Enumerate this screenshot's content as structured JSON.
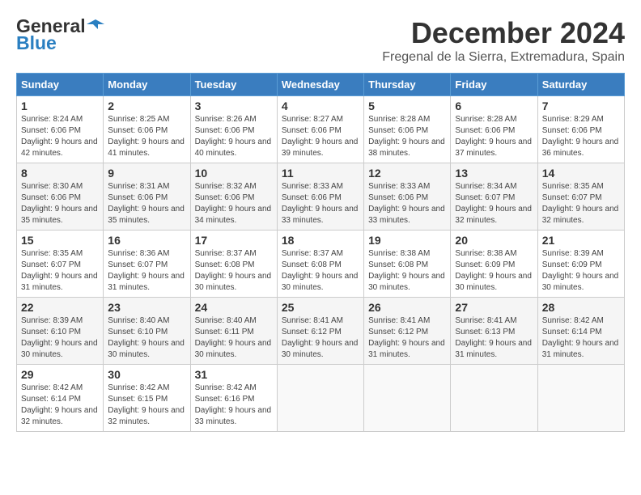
{
  "header": {
    "logo_general": "General",
    "logo_blue": "Blue",
    "month": "December 2024",
    "location": "Fregenal de la Sierra, Extremadura, Spain"
  },
  "days_of_week": [
    "Sunday",
    "Monday",
    "Tuesday",
    "Wednesday",
    "Thursday",
    "Friday",
    "Saturday"
  ],
  "weeks": [
    [
      {
        "day": 1,
        "sunrise": "8:24 AM",
        "sunset": "6:06 PM",
        "daylight": "9 hours and 42 minutes."
      },
      {
        "day": 2,
        "sunrise": "8:25 AM",
        "sunset": "6:06 PM",
        "daylight": "9 hours and 41 minutes."
      },
      {
        "day": 3,
        "sunrise": "8:26 AM",
        "sunset": "6:06 PM",
        "daylight": "9 hours and 40 minutes."
      },
      {
        "day": 4,
        "sunrise": "8:27 AM",
        "sunset": "6:06 PM",
        "daylight": "9 hours and 39 minutes."
      },
      {
        "day": 5,
        "sunrise": "8:28 AM",
        "sunset": "6:06 PM",
        "daylight": "9 hours and 38 minutes."
      },
      {
        "day": 6,
        "sunrise": "8:28 AM",
        "sunset": "6:06 PM",
        "daylight": "9 hours and 37 minutes."
      },
      {
        "day": 7,
        "sunrise": "8:29 AM",
        "sunset": "6:06 PM",
        "daylight": "9 hours and 36 minutes."
      }
    ],
    [
      {
        "day": 8,
        "sunrise": "8:30 AM",
        "sunset": "6:06 PM",
        "daylight": "9 hours and 35 minutes."
      },
      {
        "day": 9,
        "sunrise": "8:31 AM",
        "sunset": "6:06 PM",
        "daylight": "9 hours and 35 minutes."
      },
      {
        "day": 10,
        "sunrise": "8:32 AM",
        "sunset": "6:06 PM",
        "daylight": "9 hours and 34 minutes."
      },
      {
        "day": 11,
        "sunrise": "8:33 AM",
        "sunset": "6:06 PM",
        "daylight": "9 hours and 33 minutes."
      },
      {
        "day": 12,
        "sunrise": "8:33 AM",
        "sunset": "6:06 PM",
        "daylight": "9 hours and 33 minutes."
      },
      {
        "day": 13,
        "sunrise": "8:34 AM",
        "sunset": "6:07 PM",
        "daylight": "9 hours and 32 minutes."
      },
      {
        "day": 14,
        "sunrise": "8:35 AM",
        "sunset": "6:07 PM",
        "daylight": "9 hours and 32 minutes."
      }
    ],
    [
      {
        "day": 15,
        "sunrise": "8:35 AM",
        "sunset": "6:07 PM",
        "daylight": "9 hours and 31 minutes."
      },
      {
        "day": 16,
        "sunrise": "8:36 AM",
        "sunset": "6:07 PM",
        "daylight": "9 hours and 31 minutes."
      },
      {
        "day": 17,
        "sunrise": "8:37 AM",
        "sunset": "6:08 PM",
        "daylight": "9 hours and 30 minutes."
      },
      {
        "day": 18,
        "sunrise": "8:37 AM",
        "sunset": "6:08 PM",
        "daylight": "9 hours and 30 minutes."
      },
      {
        "day": 19,
        "sunrise": "8:38 AM",
        "sunset": "6:08 PM",
        "daylight": "9 hours and 30 minutes."
      },
      {
        "day": 20,
        "sunrise": "8:38 AM",
        "sunset": "6:09 PM",
        "daylight": "9 hours and 30 minutes."
      },
      {
        "day": 21,
        "sunrise": "8:39 AM",
        "sunset": "6:09 PM",
        "daylight": "9 hours and 30 minutes."
      }
    ],
    [
      {
        "day": 22,
        "sunrise": "8:39 AM",
        "sunset": "6:10 PM",
        "daylight": "9 hours and 30 minutes."
      },
      {
        "day": 23,
        "sunrise": "8:40 AM",
        "sunset": "6:10 PM",
        "daylight": "9 hours and 30 minutes."
      },
      {
        "day": 24,
        "sunrise": "8:40 AM",
        "sunset": "6:11 PM",
        "daylight": "9 hours and 30 minutes."
      },
      {
        "day": 25,
        "sunrise": "8:41 AM",
        "sunset": "6:12 PM",
        "daylight": "9 hours and 30 minutes."
      },
      {
        "day": 26,
        "sunrise": "8:41 AM",
        "sunset": "6:12 PM",
        "daylight": "9 hours and 31 minutes."
      },
      {
        "day": 27,
        "sunrise": "8:41 AM",
        "sunset": "6:13 PM",
        "daylight": "9 hours and 31 minutes."
      },
      {
        "day": 28,
        "sunrise": "8:42 AM",
        "sunset": "6:14 PM",
        "daylight": "9 hours and 31 minutes."
      }
    ],
    [
      {
        "day": 29,
        "sunrise": "8:42 AM",
        "sunset": "6:14 PM",
        "daylight": "9 hours and 32 minutes."
      },
      {
        "day": 30,
        "sunrise": "8:42 AM",
        "sunset": "6:15 PM",
        "daylight": "9 hours and 32 minutes."
      },
      {
        "day": 31,
        "sunrise": "8:42 AM",
        "sunset": "6:16 PM",
        "daylight": "9 hours and 33 minutes."
      },
      null,
      null,
      null,
      null
    ]
  ]
}
